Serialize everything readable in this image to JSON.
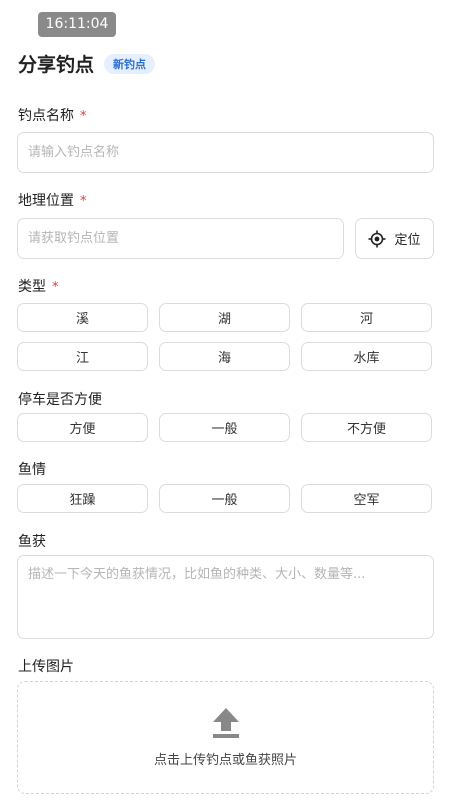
{
  "status_bar": {
    "time": "16:11:04"
  },
  "header": {
    "title": "分享钓点",
    "badge": "新钓点"
  },
  "form": {
    "spot_name": {
      "label": "钓点名称",
      "required_mark": "*",
      "placeholder": "请输入钓点名称",
      "value": ""
    },
    "location": {
      "label": "地理位置",
      "required_mark": "*",
      "placeholder": "请获取钓点位置",
      "value": "",
      "locate_button": {
        "label": "定位",
        "icon": "crosshair-locate-icon"
      }
    },
    "type": {
      "label": "类型",
      "required_mark": "*",
      "options_row1": [
        "溪",
        "湖",
        "河"
      ],
      "options_row2": [
        "江",
        "海",
        "水库"
      ]
    },
    "parking": {
      "label": "停车是否方便",
      "options": [
        "方便",
        "一般",
        "不方便"
      ]
    },
    "fish_condition": {
      "label": "鱼情",
      "options": [
        "狂躁",
        "一般",
        "空军"
      ]
    },
    "catch": {
      "label": "鱼获",
      "placeholder": "描述一下今天的鱼获情况，比如鱼的种类、大小、数量等...",
      "value": ""
    },
    "upload": {
      "label": "上传图片",
      "hint": "点击上传钓点或鱼获照片",
      "icon": "upload-arrow-icon"
    }
  },
  "colors": {
    "required": "#e53935",
    "badge_text": "#2d6fd0",
    "badge_bg": "#e6efff",
    "border": "#dcdcdc",
    "upload_icon": "#888888"
  }
}
